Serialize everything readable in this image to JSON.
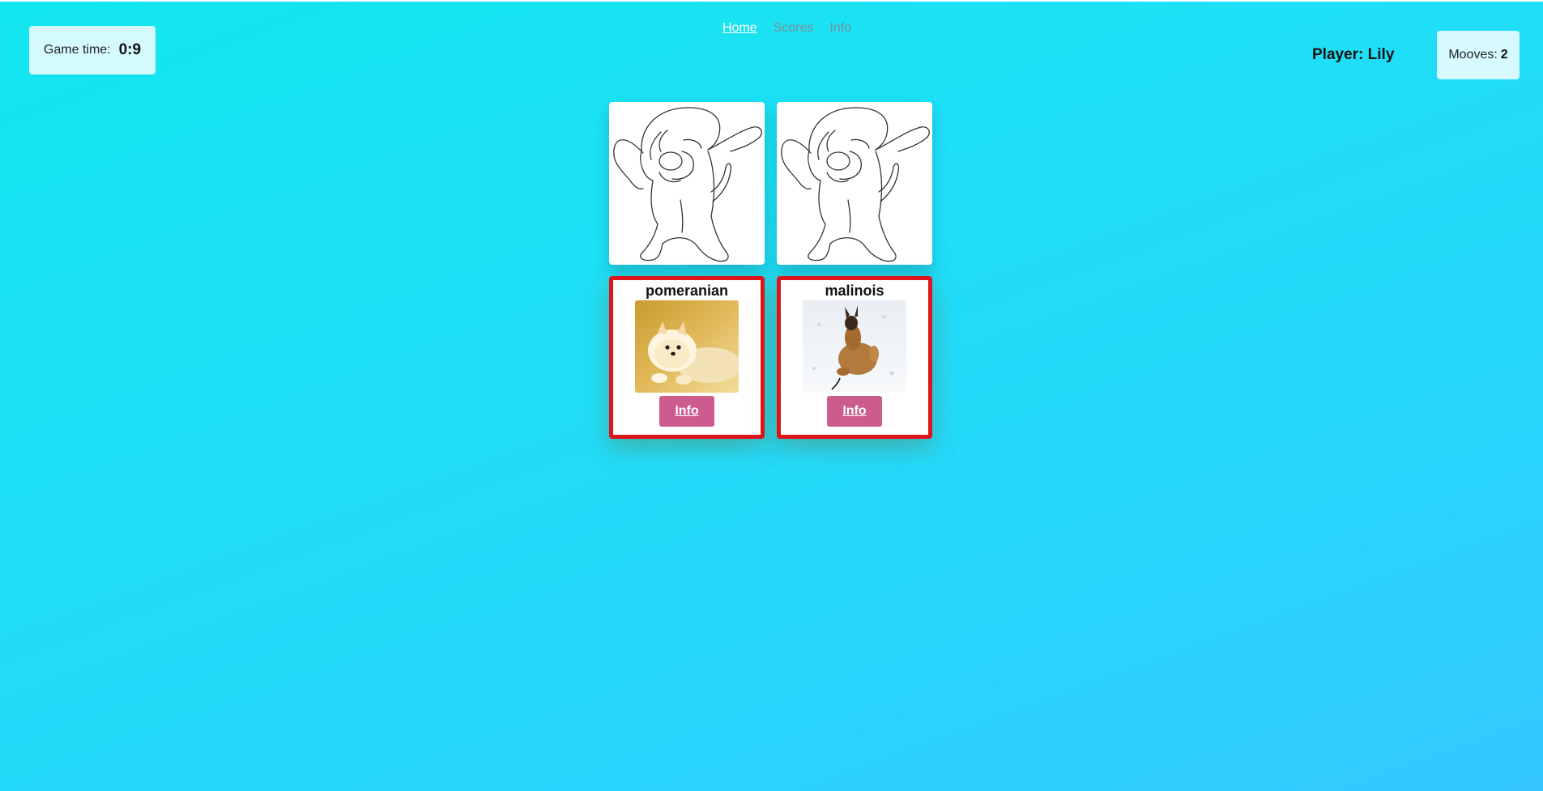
{
  "header": {
    "game_time_label": "Game time:",
    "game_time_value": "0:9",
    "nav": [
      {
        "label": "Home",
        "active": true
      },
      {
        "label": "Scores",
        "active": false
      },
      {
        "label": "Info",
        "active": false
      }
    ],
    "player_text": "Player: Lily",
    "moves_label": "Mooves:",
    "moves_value": "2"
  },
  "board": {
    "hidden_cards": [
      {
        "icon": "dabbing-dog-sketch-icon"
      },
      {
        "icon": "dabbing-dog-sketch-icon"
      }
    ],
    "revealed_cards": [
      {
        "breed": "pomeranian",
        "photo": "pomeranian-photo",
        "button": "Info"
      },
      {
        "breed": "malinois",
        "photo": "malinois-photo",
        "button": "Info"
      }
    ]
  },
  "colors": {
    "revealed_border": "#e0141c",
    "info_button": "#cc5b8e",
    "nav_active": "#ffffff",
    "nav_inactive": "#7a8f97"
  }
}
